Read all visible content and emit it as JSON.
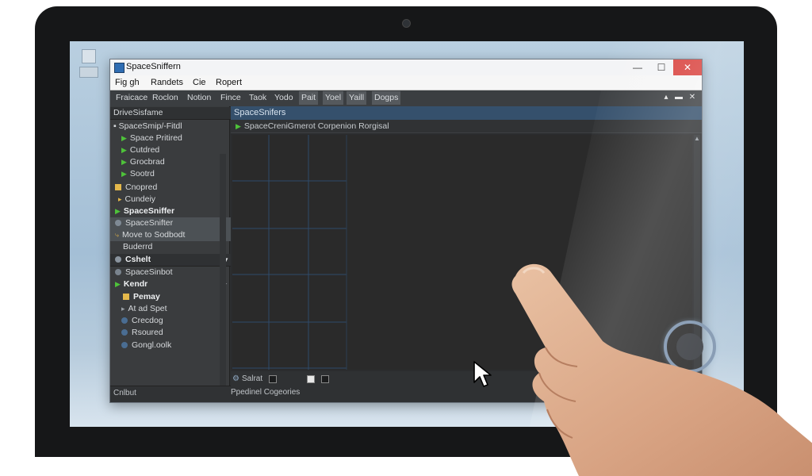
{
  "window": {
    "title": "SpaceSniffern",
    "controls": {
      "minimize": "—",
      "maximize": "☐",
      "close": "✕"
    }
  },
  "menu": [
    "Fig gh",
    "Randets",
    "Cie",
    "Ropert"
  ],
  "toolbar": {
    "items": [
      "Fraicace",
      "Roclon",
      "Notion",
      "Fince",
      "Taok",
      "Yodo",
      "Pait",
      "Yoel",
      "Yaill",
      "Dogps"
    ],
    "right_controls": [
      "▴",
      "▬",
      "✕"
    ]
  },
  "sidebar": {
    "header": "DriveSisfame",
    "items": [
      {
        "label": "SpaceSmip/-Fitdl",
        "icon": "expander-icon"
      },
      {
        "label": "Space Pritired",
        "icon": "play-arrow-icon"
      },
      {
        "label": "Cutdred",
        "icon": "play-arrow-icon"
      },
      {
        "label": "Grocbrad",
        "icon": "play-arrow-icon"
      },
      {
        "label": "Sootrd",
        "icon": "play-arrow-icon"
      },
      {
        "label": "Cnopred",
        "icon": "folder-icon"
      },
      {
        "label": "Cundeiy",
        "icon": "small-arrow-icon"
      },
      {
        "label": "SpaceSniffer",
        "icon": "play-arrow-icon"
      },
      {
        "label": "SpaceSnifter",
        "icon": "drive-icon"
      },
      {
        "label": "Move to Sodbodt",
        "icon": "move-icon"
      },
      {
        "label": "Buderrd",
        "icon": "none"
      },
      {
        "label": "Cshelt",
        "icon": "drive-icon"
      },
      {
        "label": "SpaceSinbot",
        "icon": "drive-icon"
      },
      {
        "label": "Kendr",
        "icon": "play-arrow-icon"
      },
      {
        "label": "Pemay",
        "icon": "folder-icon"
      },
      {
        "label": "At ad Spet",
        "icon": "small-arrow-icon"
      },
      {
        "label": "Crecdog",
        "icon": "drive-icon"
      },
      {
        "label": "Rsoured",
        "icon": "drive-icon"
      },
      {
        "label": "Gongl.oolk",
        "icon": "drive-icon"
      }
    ],
    "footer": "Cnlbut"
  },
  "main": {
    "header": "SpaceSnifers",
    "subheader": "SpaceCreniGmerot Corpenion Rorgisal",
    "footer": {
      "row1": "Salrat",
      "row2": "Ppedinel Cogeories"
    }
  },
  "colors": {
    "accent": "#35506c",
    "play_arrow": "#4ec23a",
    "folder": "#e4b84b",
    "close_button": "#d9433f",
    "grid_line": "#2f4a6a"
  }
}
